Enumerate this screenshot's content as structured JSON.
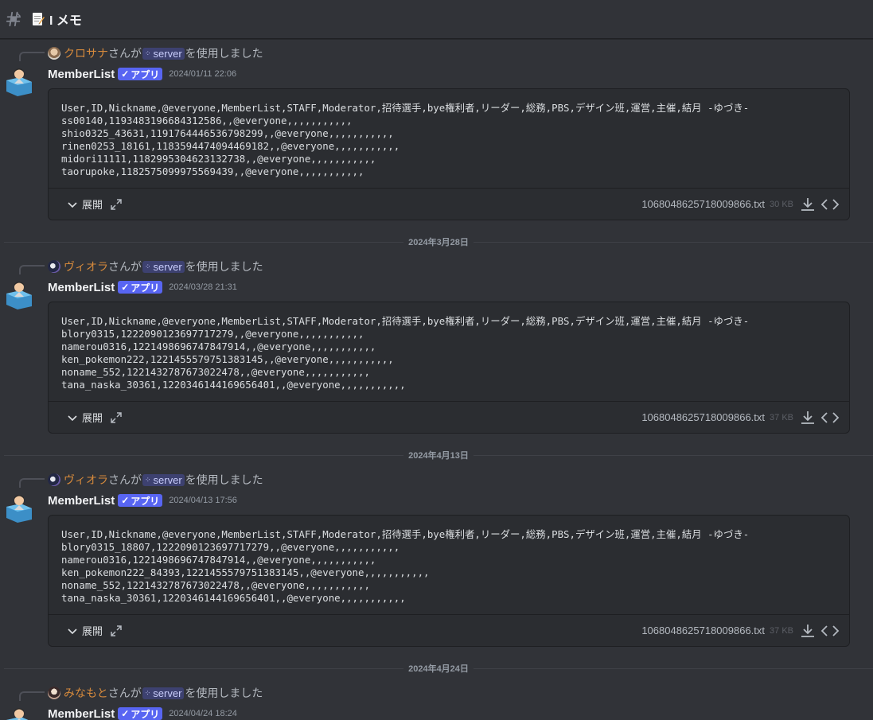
{
  "channel": {
    "title": "I メモ"
  },
  "messages": [
    {
      "reply": {
        "user": "クロサナ",
        "mid": "さんが",
        "command": "server",
        "suffix": "を使用しました"
      },
      "author": "MemberList",
      "badge": "アプリ",
      "timestamp": "2024/01/11 22:06",
      "preview": "User,ID,Nickname,@everyone,MemberList,STAFF,Moderator,招待選手,bye権利者,リーダー,総務,PBS,デザイン班,運営,主催,結月 -ゆづき-\nss00140,1193483196684312586,,@everyone,,,,,,,,,,,\nshio0325_43631,1191764446536798299,,@everyone,,,,,,,,,,,\nrinen0253_18161,1183594474094469182,,@everyone,,,,,,,,,,,\nmidori11111,1182995304623132738,,@everyone,,,,,,,,,,,\ntaorupoke,1182575099975569439,,@everyone,,,,,,,,,,,",
      "expand_label": "展開",
      "file_name": "1068048625718009866.txt",
      "file_size": "30 KB"
    },
    {
      "reply": {
        "user": "ヴィオラ",
        "mid": "さんが",
        "command": "server",
        "suffix": "を使用しました"
      },
      "author": "MemberList",
      "badge": "アプリ",
      "timestamp": "2024/03/28 21:31",
      "preview": "User,ID,Nickname,@everyone,MemberList,STAFF,Moderator,招待選手,bye権利者,リーダー,総務,PBS,デザイン班,運営,主催,結月 -ゆづき-\nblory0315,1222090123697717279,,@everyone,,,,,,,,,,,\nnamerou0316,1221498696747847914,,@everyone,,,,,,,,,,,\nken_pokemon222,1221455579751383145,,@everyone,,,,,,,,,,,\nnoname_552,1221432787673022478,,@everyone,,,,,,,,,,,\ntana_naska_30361,1220346144169656401,,@everyone,,,,,,,,,,,",
      "expand_label": "展開",
      "file_name": "1068048625718009866.txt",
      "file_size": "37 KB"
    },
    {
      "reply": {
        "user": "ヴィオラ",
        "mid": "さんが",
        "command": "server",
        "suffix": "を使用しました"
      },
      "author": "MemberList",
      "badge": "アプリ",
      "timestamp": "2024/04/13 17:56",
      "preview": "User,ID,Nickname,@everyone,MemberList,STAFF,Moderator,招待選手,bye権利者,リーダー,総務,PBS,デザイン班,運営,主催,結月 -ゆづき-\nblory0315_18807,1222090123697717279,,@everyone,,,,,,,,,,,\nnamerou0316,1221498696747847914,,@everyone,,,,,,,,,,,\nken_pokemon222_84393,1221455579751383145,,@everyone,,,,,,,,,,,\nnoname_552,1221432787673022478,,@everyone,,,,,,,,,,,\ntana_naska_30361,1220346144169656401,,@everyone,,,,,,,,,,,",
      "expand_label": "展開",
      "file_name": "1068048625718009866.txt",
      "file_size": "37 KB"
    },
    {
      "reply": {
        "user": "みなもと",
        "mid": "さんが",
        "command": "server",
        "suffix": "を使用しました"
      },
      "author": "MemberList",
      "badge": "アプリ",
      "timestamp": "2024/04/24 18:24"
    }
  ],
  "dividers": [
    "2024年3月28日",
    "2024年4月13日",
    "2024年4月24日"
  ],
  "colors": {
    "accent": "#5865f2",
    "reply_name": "#d68a3c",
    "background": "#313338",
    "attachment_bg": "#2b2d31"
  },
  "icons": {
    "channel": "hash-icon",
    "memo": "memo-icon",
    "download": "download-icon",
    "code": "code-icon",
    "expand": "chevron-down-icon",
    "fullscreen": "fullscreen-icon"
  }
}
